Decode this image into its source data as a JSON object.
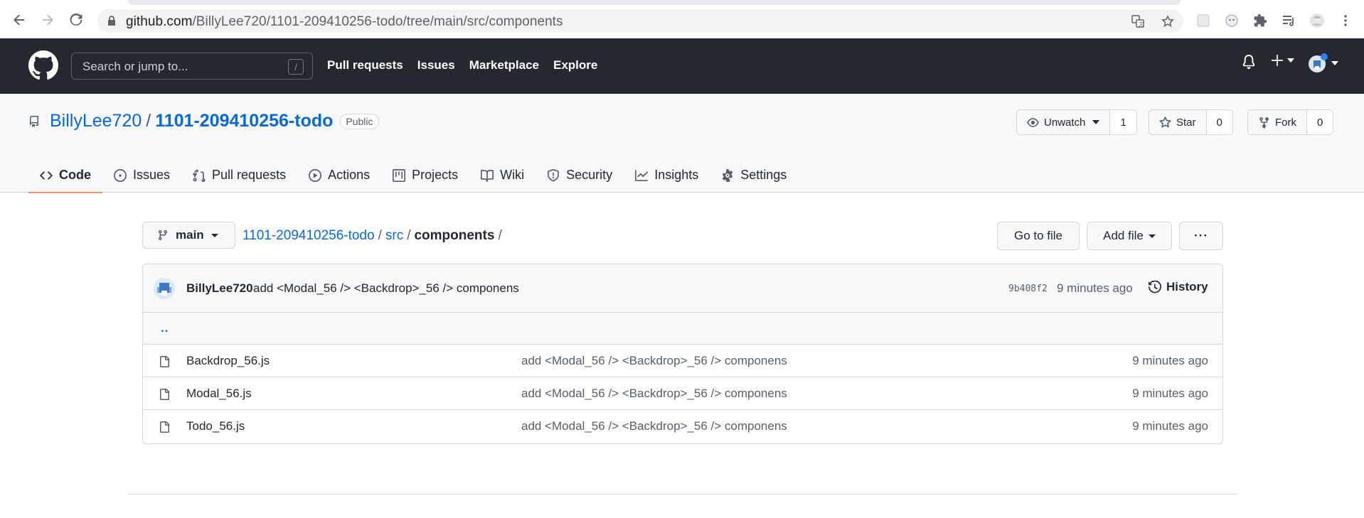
{
  "browser": {
    "url_host": "github.com",
    "url_path": "/BillyLee720/1101-209410256-todo/tree/main/src/components"
  },
  "header": {
    "search_placeholder": "Search or jump to...",
    "search_shortcut": "/",
    "nav": [
      "Pull requests",
      "Issues",
      "Marketplace",
      "Explore"
    ]
  },
  "repo": {
    "owner": "BillyLee720",
    "separator": "/",
    "name": "1101-209410256-todo",
    "visibility": "Public",
    "unwatch_label": "Unwatch",
    "watch_count": "1",
    "star_label": "Star",
    "star_count": "0",
    "fork_label": "Fork",
    "fork_count": "0"
  },
  "tabs": {
    "code": "Code",
    "issues": "Issues",
    "pull_requests": "Pull requests",
    "actions": "Actions",
    "projects": "Projects",
    "wiki": "Wiki",
    "security": "Security",
    "insights": "Insights",
    "settings": "Settings"
  },
  "file_nav": {
    "branch": "main",
    "crumb_repo": "1101-209410256-todo",
    "crumb_src": "src",
    "crumb_current": "components",
    "sep": "/",
    "go_to_file": "Go to file",
    "add_file": "Add file",
    "more": "···"
  },
  "latest_commit": {
    "author": "BillyLee720",
    "message": "add <Modal_56 /> <Backdrop>_56 /> componens",
    "sha": "9b408f2",
    "age": "9 minutes ago",
    "history_label": "History"
  },
  "parent_dir": "..",
  "files": [
    {
      "name": "Backdrop_56.js",
      "message": "add <Modal_56 /> <Backdrop>_56 /> componens",
      "age": "9 minutes ago"
    },
    {
      "name": "Modal_56.js",
      "message": "add <Modal_56 /> <Backdrop>_56 /> componens",
      "age": "9 minutes ago"
    },
    {
      "name": "Todo_56.js",
      "message": "add <Modal_56 /> <Backdrop>_56 /> componens",
      "age": "9 minutes ago"
    }
  ],
  "colors": {
    "header_bg": "#24292f",
    "link": "#0969da",
    "tab_underline": "#fd8c73",
    "border": "#d0d7de",
    "subtle_bg": "#f6f8fa"
  }
}
